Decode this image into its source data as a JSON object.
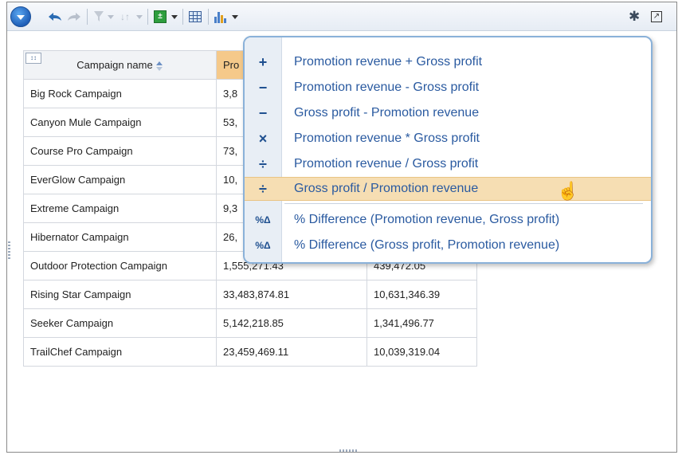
{
  "icons": {
    "menu_orb": "menu-orb-icon",
    "undo": "undo-icon",
    "redo": "redo-icon",
    "filter": "filter-icon",
    "sort": "sort-icon",
    "calculate": "calculate-icon",
    "table": "table-icon",
    "chart": "chart-icon",
    "swap": "swap-icon",
    "conditional_style": "conditional-style-icon",
    "settings": "gear-icon",
    "expand": "expand-icon"
  },
  "table": {
    "corner_tag": "↕↕",
    "headers": [
      "Campaign name",
      "Pro",
      ""
    ],
    "rows": [
      [
        "Big Rock Campaign",
        "3,8",
        ""
      ],
      [
        "Canyon Mule Campaign",
        "53,",
        ""
      ],
      [
        "Course Pro Campaign",
        "73,",
        ""
      ],
      [
        "EverGlow Campaign",
        "10,",
        ""
      ],
      [
        "Extreme Campaign",
        "9,3",
        ""
      ],
      [
        "Hibernator Campaign",
        "26,",
        ""
      ],
      [
        "Outdoor Protection Campaign",
        "1,555,271.43",
        "439,472.05"
      ],
      [
        "Rising Star Campaign",
        "33,483,874.81",
        "10,631,346.39"
      ],
      [
        "Seeker Campaign",
        "5,142,218.85",
        "1,341,496.77"
      ],
      [
        "TrailChef Campaign",
        "23,459,469.11",
        "10,039,319.04"
      ]
    ]
  },
  "calc_menu": {
    "items": [
      {
        "icon": "+",
        "label": "Promotion revenue + Gross profit"
      },
      {
        "icon": "−",
        "label": "Promotion revenue - Gross profit"
      },
      {
        "icon": "−",
        "label": "Gross profit - Promotion revenue"
      },
      {
        "icon": "×",
        "label": "Promotion revenue * Gross profit"
      },
      {
        "icon": "÷",
        "label": "Promotion revenue / Gross profit"
      },
      {
        "icon": "÷",
        "label": "Gross profit / Promotion revenue"
      },
      {
        "icon": "%Δ",
        "label": "% Difference (Promotion revenue, Gross profit)"
      },
      {
        "icon": "%Δ",
        "label": "% Difference (Gross profit, Promotion revenue)"
      }
    ],
    "selected_index": 5
  },
  "colors": {
    "menu_selected": "#f6deb3",
    "menu_text": "#2a5aa0",
    "header_highlight": "#f5c98a",
    "popup_border": "#8ab1d9"
  }
}
